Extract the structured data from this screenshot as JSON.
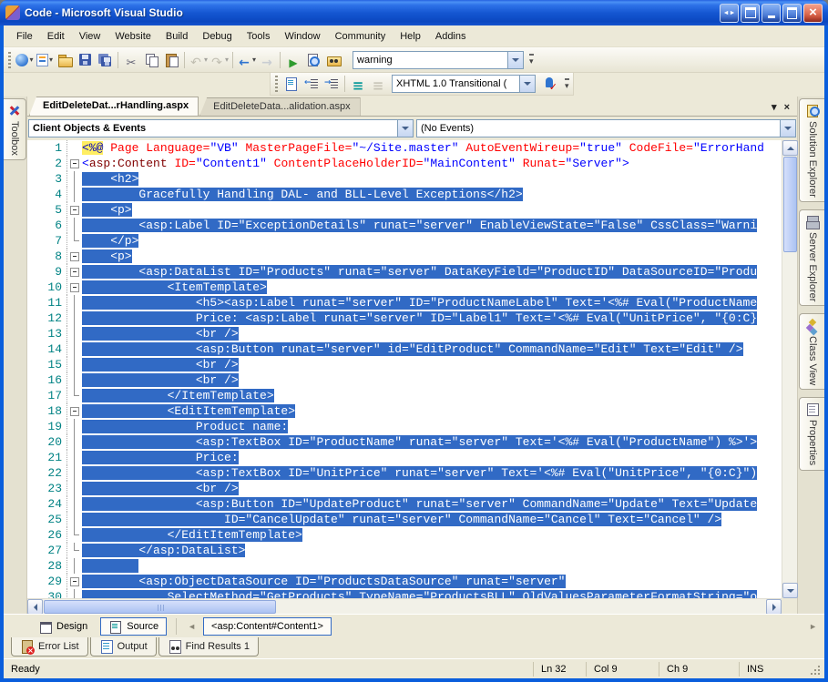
{
  "window": {
    "title": "Code - Microsoft Visual Studio",
    "controls": [
      {
        "icon": "window-arrows",
        "style": "blue"
      },
      {
        "icon": "window-popout",
        "style": "blue"
      },
      {
        "icon": "minimize",
        "style": "blue"
      },
      {
        "icon": "maximize",
        "style": "blue"
      },
      {
        "icon": "close",
        "style": "red"
      }
    ]
  },
  "menu": {
    "items": [
      "File",
      "Edit",
      "View",
      "Website",
      "Build",
      "Debug",
      "Tools",
      "Window",
      "Community",
      "Help",
      "Addins"
    ]
  },
  "toolbar_main": {
    "items": [
      {
        "type": "button",
        "icon": "new-website",
        "caret": true
      },
      {
        "type": "button",
        "icon": "add-new-item",
        "caret": true
      },
      {
        "type": "button",
        "icon": "open-file"
      },
      {
        "type": "button",
        "icon": "save"
      },
      {
        "type": "button",
        "icon": "save-all"
      },
      {
        "type": "sep"
      },
      {
        "type": "button",
        "icon": "cut"
      },
      {
        "type": "button",
        "icon": "copy"
      },
      {
        "type": "button",
        "icon": "paste"
      },
      {
        "type": "sep"
      },
      {
        "type": "button",
        "icon": "undo",
        "caret": true,
        "disabled": true
      },
      {
        "type": "button",
        "icon": "redo",
        "caret": true,
        "disabled": true
      },
      {
        "type": "sep"
      },
      {
        "type": "button",
        "icon": "navigate-backward",
        "caret": true
      },
      {
        "type": "button",
        "icon": "navigate-forward",
        "disabled": true
      },
      {
        "type": "sep"
      },
      {
        "type": "button",
        "icon": "start-debug"
      },
      {
        "type": "button",
        "icon": "view-in-browser"
      },
      {
        "type": "button",
        "icon": "find-in-files"
      }
    ],
    "search_value": "warning"
  },
  "toolbar_html": {
    "items": [
      {
        "type": "button",
        "icon": "format-document"
      },
      {
        "type": "button",
        "icon": "decrease-indent"
      },
      {
        "type": "button",
        "icon": "increase-indent"
      },
      {
        "type": "sep"
      },
      {
        "type": "button",
        "icon": "comment-selection"
      },
      {
        "type": "button",
        "icon": "uncomment-selection",
        "disabled": true
      }
    ],
    "doctype_value": "XHTML 1.0 Transitional (",
    "accessibility_button": "check-page-accessibility"
  },
  "doc_tabs": [
    {
      "label": "EditDeleteDat...rHandling.aspx",
      "active": true
    },
    {
      "label": "EditDeleteData...alidation.aspx",
      "active": false
    }
  ],
  "navbar": {
    "left_dropdown": "Client Objects & Events",
    "right_dropdown": "(No Events)"
  },
  "left_tab": {
    "label": "Toolbox",
    "icon": "toolbox"
  },
  "right_tabs": [
    {
      "label": "Solution Explorer",
      "icon": "solution-explorer"
    },
    {
      "label": "Server Explorer",
      "icon": "server-explorer"
    },
    {
      "label": "Class View",
      "icon": "class-view"
    },
    {
      "label": "Properties",
      "icon": "properties"
    }
  ],
  "editor": {
    "lines": [
      {
        "n": 1,
        "fold": "none",
        "segments": [
          {
            "c": "dir",
            "t": "<%@"
          },
          {
            "c": "plain",
            "t": " "
          },
          {
            "c": "attr",
            "t": "Page Language="
          },
          {
            "c": "val",
            "t": "\"VB\""
          },
          {
            "c": "attr",
            "t": " MasterPageFile="
          },
          {
            "c": "val",
            "t": "\"~/Site.master\""
          },
          {
            "c": "attr",
            "t": " AutoEventWireup="
          },
          {
            "c": "val",
            "t": "\"true\""
          },
          {
            "c": "attr",
            "t": " CodeFile="
          },
          {
            "c": "val",
            "t": "\"ErrorHand"
          }
        ]
      },
      {
        "n": 2,
        "fold": "box",
        "segments": [
          {
            "c": "delim",
            "t": "<"
          },
          {
            "c": "tag",
            "t": "asp:Content"
          },
          {
            "c": "attr",
            "t": " ID="
          },
          {
            "c": "val",
            "t": "\"Content1\""
          },
          {
            "c": "attr",
            "t": " ContentPlaceHolderID="
          },
          {
            "c": "val",
            "t": "\"MainContent\""
          },
          {
            "c": "attr",
            "t": " Runat="
          },
          {
            "c": "val",
            "t": "\"Server\""
          },
          {
            "c": "delim",
            "t": ">"
          }
        ]
      },
      {
        "n": 3,
        "fold": "line",
        "selected": true,
        "text": "    <h2>"
      },
      {
        "n": 4,
        "fold": "line",
        "selected": true,
        "text": "        Gracefully Handling DAL- and BLL-Level Exceptions</h2>"
      },
      {
        "n": 5,
        "fold": "box",
        "selected": true,
        "text": "    <p>"
      },
      {
        "n": 6,
        "fold": "line",
        "selected": true,
        "text": "        <asp:Label ID=\"ExceptionDetails\" runat=\"server\" EnableViewState=\"False\" CssClass=\"Warni"
      },
      {
        "n": 7,
        "fold": "tick",
        "selected": true,
        "text": "    </p>"
      },
      {
        "n": 8,
        "fold": "box",
        "selected": true,
        "text": "    <p>"
      },
      {
        "n": 9,
        "fold": "box",
        "selected": true,
        "text": "        <asp:DataList ID=\"Products\" runat=\"server\" DataKeyField=\"ProductID\" DataSourceID=\"Produ"
      },
      {
        "n": 10,
        "fold": "box",
        "selected": true,
        "text": "            <ItemTemplate>"
      },
      {
        "n": 11,
        "fold": "line",
        "selected": true,
        "text": "                <h5><asp:Label runat=\"server\" ID=\"ProductNameLabel\" Text='<%# Eval(\"ProductName"
      },
      {
        "n": 12,
        "fold": "line",
        "selected": true,
        "text": "                Price: <asp:Label runat=\"server\" ID=\"Label1\" Text='<%# Eval(\"UnitPrice\", \"{0:C}"
      },
      {
        "n": 13,
        "fold": "line",
        "selected": true,
        "text": "                <br />"
      },
      {
        "n": 14,
        "fold": "line",
        "selected": true,
        "text": "                <asp:Button runat=\"server\" id=\"EditProduct\" CommandName=\"Edit\" Text=\"Edit\" />"
      },
      {
        "n": 15,
        "fold": "line",
        "selected": true,
        "text": "                <br />"
      },
      {
        "n": 16,
        "fold": "line",
        "selected": true,
        "text": "                <br />"
      },
      {
        "n": 17,
        "fold": "tick",
        "selected": true,
        "text": "            </ItemTemplate>"
      },
      {
        "n": 18,
        "fold": "box",
        "selected": true,
        "text": "            <EditItemTemplate>"
      },
      {
        "n": 19,
        "fold": "line",
        "selected": true,
        "text": "                Product name:"
      },
      {
        "n": 20,
        "fold": "line",
        "selected": true,
        "text": "                <asp:TextBox ID=\"ProductName\" runat=\"server\" Text='<%# Eval(\"ProductName\") %>'>"
      },
      {
        "n": 21,
        "fold": "line",
        "selected": true,
        "text": "                Price:"
      },
      {
        "n": 22,
        "fold": "line",
        "selected": true,
        "text": "                <asp:TextBox ID=\"UnitPrice\" runat=\"server\" Text='<%# Eval(\"UnitPrice\", \"{0:C}\")"
      },
      {
        "n": 23,
        "fold": "line",
        "selected": true,
        "text": "                <br />"
      },
      {
        "n": 24,
        "fold": "line",
        "selected": true,
        "text": "                <asp:Button ID=\"UpdateProduct\" runat=\"server\" CommandName=\"Update\" Text=\"Update"
      },
      {
        "n": 25,
        "fold": "line",
        "selected": true,
        "text": "                    ID=\"CancelUpdate\" runat=\"server\" CommandName=\"Cancel\" Text=\"Cancel\" />"
      },
      {
        "n": 26,
        "fold": "tick",
        "selected": true,
        "text": "            </EditItemTemplate>"
      },
      {
        "n": 27,
        "fold": "tick",
        "selected": true,
        "text": "        </asp:DataList>"
      },
      {
        "n": 28,
        "fold": "line",
        "selected": true,
        "text": "        "
      },
      {
        "n": 29,
        "fold": "box",
        "selected": true,
        "text": "        <asp:ObjectDataSource ID=\"ProductsDataSource\" runat=\"server\""
      },
      {
        "n": 30,
        "fold": "line",
        "selected": true,
        "text": "            SelectMethod=\"GetProducts\" TypeName=\"ProductsBLL\" OldValuesParameterFormatString=\"o"
      }
    ]
  },
  "viewbar": {
    "design_label": "Design",
    "source_label": "Source",
    "tag_navigator": "<asp:Content#Content1>"
  },
  "panels": [
    {
      "label": "Error List",
      "icon": "error-list"
    },
    {
      "label": "Output",
      "icon": "output"
    },
    {
      "label": "Find Results 1",
      "icon": "find-results"
    }
  ],
  "statusbar": {
    "message": "Ready",
    "cells": [
      "Ln 32",
      "Col 9",
      "Ch 9",
      "INS"
    ]
  },
  "colors": {
    "selection": "#316AC5",
    "frame_blue": "#0A5EDC",
    "chrome": "#ECE9D8",
    "directive_bg": "#FFEE62",
    "tag_name": "#800000",
    "attribute_name": "#FF0000",
    "attribute_value": "#0000FF",
    "line_number": "#008284"
  }
}
